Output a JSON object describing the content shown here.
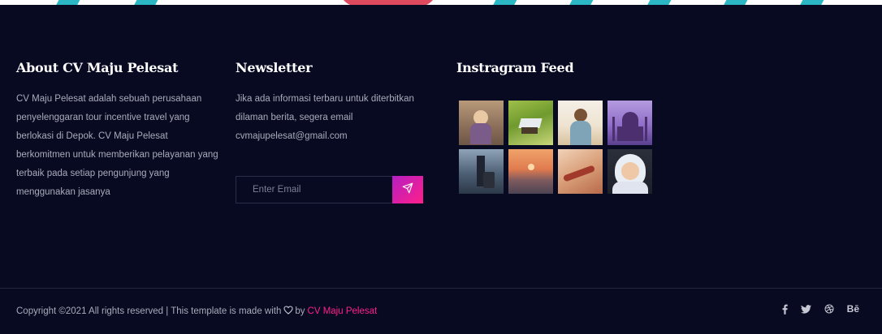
{
  "about": {
    "title": "About CV Maju Pelesat",
    "text": "CV Maju Pelesat adalah sebuah perusahaan penyelenggaran tour incentive travel yang berlokasi di Depok. CV Maju Pelesat berkomitmen untuk memberikan pelayanan yang terbaik pada setiap pengunjung yang menggunakan jasanya"
  },
  "newsletter": {
    "title": "Newsletter",
    "text": "Jika ada informasi terbaru untuk diterbitkan dilaman berita, segera email cvmajupelesat@gmail.com",
    "placeholder": "Enter Email",
    "send_icon": "paper-plane-icon"
  },
  "instagram": {
    "title": "Instragram Feed",
    "photos": [
      "child-with-backpack",
      "hut-in-rice-field",
      "woman-with-backpack",
      "taj-mahal-purple-sky",
      "traveler-with-suitcase",
      "sunset-beach",
      "hands-with-bracelets",
      "child-in-white-hood"
    ]
  },
  "footer": {
    "copyright_prefix": "Copyright ©2021 All rights reserved | This template is made with",
    "by": "by",
    "brand": "CV Maju Pelesat",
    "social": [
      "facebook-icon",
      "twitter-icon",
      "dribbble-icon",
      "behance-icon"
    ],
    "behance_label": "Bē"
  },
  "colors": {
    "background": "#080a22",
    "accent": "#ff1f8a",
    "accent_purple": "#b51fc2",
    "text_muted": "#a9abbb"
  }
}
